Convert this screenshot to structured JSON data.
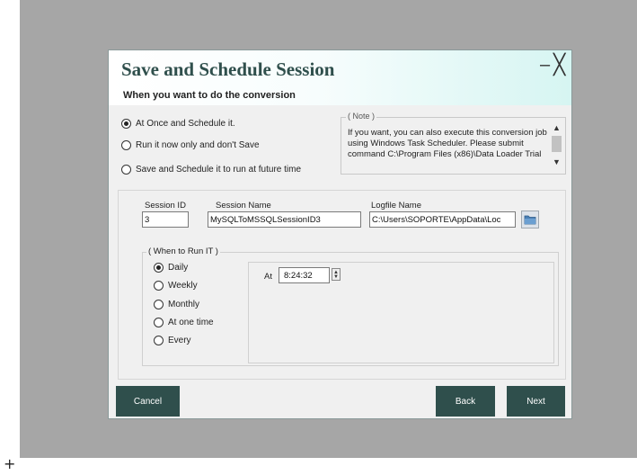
{
  "dialog": {
    "title": "Save and Schedule Session",
    "subtitle": "When you want to do the conversion",
    "minimize_symbol": "–",
    "close_symbol": "╳"
  },
  "save_options": [
    {
      "label": "At Once and Schedule it.",
      "selected": true
    },
    {
      "label": "Run it now only and don't Save",
      "selected": false
    },
    {
      "label": "Save and Schedule it to run at future time",
      "selected": false
    }
  ],
  "note": {
    "legend": "( Note )",
    "text": "If you want, you can also execute this conversion job using Windows Task Scheduler. Please submit command C:\\Program Files (x86)\\Data Loader Trial"
  },
  "session": {
    "id_label": "Session ID",
    "id_value": "3",
    "name_label": "Session Name",
    "name_value": "MySQLToMSSQLSessionID3",
    "logfile_label": "Logfile Name",
    "logfile_value": "C:\\Users\\SOPORTE\\AppData\\Loc"
  },
  "schedule": {
    "legend": "( When to Run IT )",
    "options": [
      {
        "label": "Daily",
        "selected": true
      },
      {
        "label": "Weekly",
        "selected": false
      },
      {
        "label": "Monthly",
        "selected": false
      },
      {
        "label": "At one time",
        "selected": false
      },
      {
        "label": "Every",
        "selected": false
      }
    ],
    "at_label": "At",
    "time_value": "8:24:32"
  },
  "buttons": {
    "cancel": "Cancel",
    "back": "Back",
    "next": "Next"
  },
  "cursor_symbol": "+",
  "icons": {
    "folder": "folder-icon",
    "scroll_up": "chevron-up-icon",
    "scroll_down": "chevron-down-icon"
  },
  "colors": {
    "accent": "#2f4f4c",
    "backdrop": "#a6a6a6"
  }
}
